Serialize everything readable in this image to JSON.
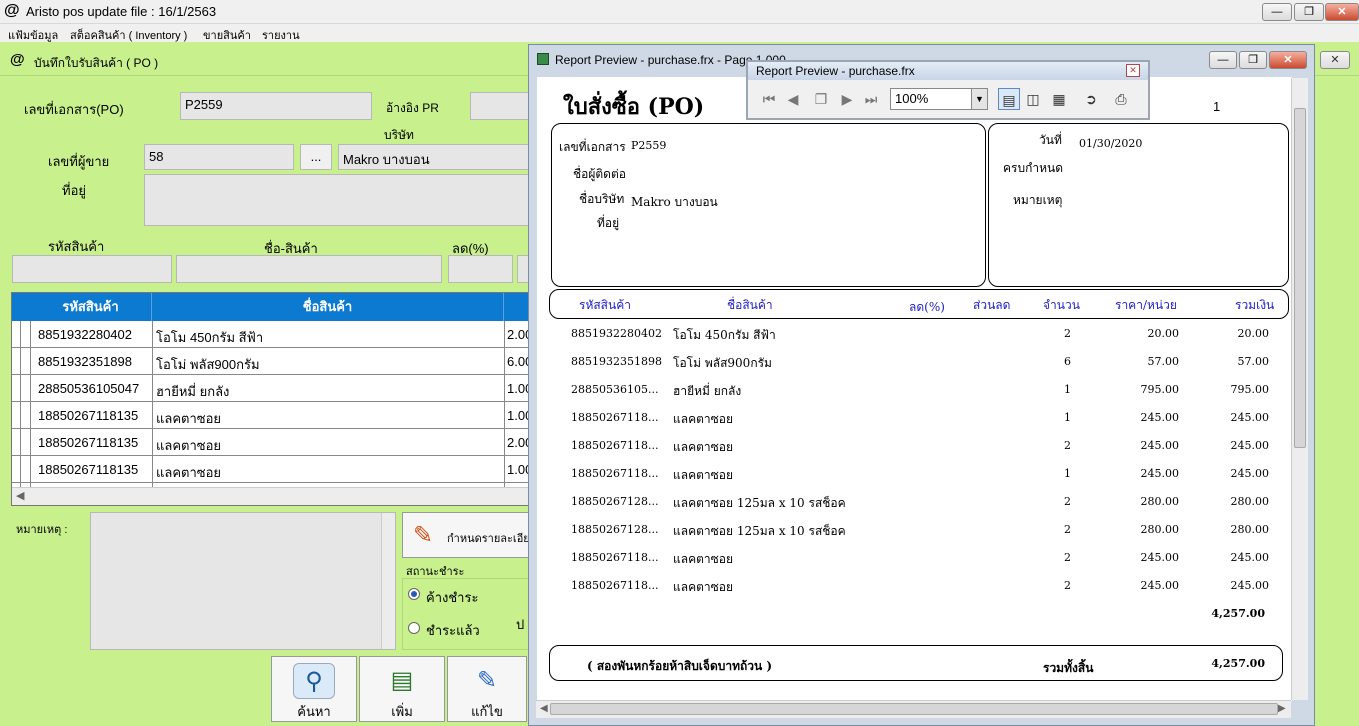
{
  "app": {
    "icon": "@",
    "title": "Aristo pos  update file : 16/1/2563"
  },
  "menu": [
    "แฟ้มข้อมูล",
    "สต็อคสินค้า ( Inventory )",
    "ขายสินค้า",
    "รายงาน"
  ],
  "po_window": {
    "icon": "@",
    "title": "บันทึกใบรับสินค้า ( PO )",
    "labels": {
      "doc_no": "เลขที่เอกสาร(PO)",
      "ref_pr": "อ้างอิง PR",
      "company": "บริษัท",
      "vendor_no": "เลขที่ผู้ขาย",
      "address": "ที่อยู่",
      "product_code": "รหัสสินค้า",
      "product_name": "ชื่อ-สินค้า",
      "discount_pct": "ลด(%)",
      "remark": "หมายเหตุ :",
      "payment_status": "สถานะชำระ",
      "unpaid": "ค้างชำระ",
      "paid": "ชำระแล้ว",
      "set_details": "กำหนดรายละเอียด",
      "stray_char": "ป"
    },
    "values": {
      "doc_no": "P2559",
      "vendor_no": "58",
      "browse": "...",
      "company": "Makro บางบอน"
    },
    "grid": {
      "headers": [
        "รหัสสินค้า",
        "ชื่อสินค้า"
      ],
      "rows": [
        {
          "code": "8851932280402",
          "name": "โอโม 450กรัม สีฟ้า",
          "qty": "2.00"
        },
        {
          "code": "8851932351898",
          "name": "โอโม่ พลัส900กรัม",
          "qty": "6.00"
        },
        {
          "code": "28850536105047",
          "name": "ฮายีหมี่ ยกลัง",
          "qty": "1.00"
        },
        {
          "code": "18850267118135",
          "name": "แลคตาซอย",
          "qty": "1.00"
        },
        {
          "code": "18850267118135",
          "name": "แลคตาซอย",
          "qty": "2.00"
        },
        {
          "code": "18850267118135",
          "name": "แลคตาซอย",
          "qty": "1.00"
        }
      ]
    },
    "buttons": {
      "search": "ค้นหา",
      "add": "เพิ่ม",
      "edit": "แก้ไข"
    }
  },
  "report_preview": {
    "title": "Report Preview - purchase.frx - Page 1 000",
    "toolbar_title": "Report Preview - purchase.frx",
    "zoom": "100%",
    "doc_title": "ใบสั่งซื้อ (PO)",
    "page_no": "1",
    "header": {
      "doc_no_label": "เลขที่เอกสาร",
      "doc_no": "P2559",
      "contact_label": "ชื่อผู้ติดต่อ",
      "company_label": "ชื่อบริษัท",
      "company": "Makro บางบอน",
      "address_label": "ที่อยู่",
      "date_label": "วันที่",
      "date": "01/30/2020",
      "due_label": "ครบกำหนด",
      "remark_label": "หมายเหตุ"
    },
    "columns": [
      "รหัสสินค้า",
      "ชื่อสินค้า",
      "ลด(%)",
      "ส่วนลด",
      "จำนวน",
      "ราคา/หน่วย",
      "รวมเงิน"
    ],
    "items": [
      {
        "code": "8851932280402",
        "name": "โอโม 450กรัม สีฟ้า",
        "qty": "2",
        "price": "20.00",
        "total": "20.00"
      },
      {
        "code": "8851932351898",
        "name": "โอโม่ พลัส900กรัม",
        "qty": "6",
        "price": "57.00",
        "total": "57.00"
      },
      {
        "code": "28850536105...",
        "name": "ฮายีหมี่ ยกลัง",
        "qty": "1",
        "price": "795.00",
        "total": "795.00"
      },
      {
        "code": "18850267118...",
        "name": "แลคตาซอย",
        "qty": "1",
        "price": "245.00",
        "total": "245.00"
      },
      {
        "code": "18850267118...",
        "name": "แลคตาซอย",
        "qty": "2",
        "price": "245.00",
        "total": "245.00"
      },
      {
        "code": "18850267118...",
        "name": "แลคตาซอย",
        "qty": "1",
        "price": "245.00",
        "total": "245.00"
      },
      {
        "code": "18850267128...",
        "name": "แลคตาซอย 125มล x 10 รสช็อค",
        "qty": "2",
        "price": "280.00",
        "total": "280.00"
      },
      {
        "code": "18850267128...",
        "name": "แลคตาซอย 125มล x 10 รสช็อค",
        "qty": "2",
        "price": "280.00",
        "total": "280.00"
      },
      {
        "code": "18850267118...",
        "name": "แลคตาซอย",
        "qty": "2",
        "price": "245.00",
        "total": "245.00"
      },
      {
        "code": "18850267118...",
        "name": "แลคตาซอย",
        "qty": "2",
        "price": "245.00",
        "total": "245.00"
      }
    ],
    "subtotal": "4,257.00",
    "amount_words": "( สองพันหกร้อยห้าสิบเจ็ดบาทถ้วน )",
    "grand_total_label": "รวมทั้งสิ้น",
    "grand_total": "4,257.00"
  }
}
